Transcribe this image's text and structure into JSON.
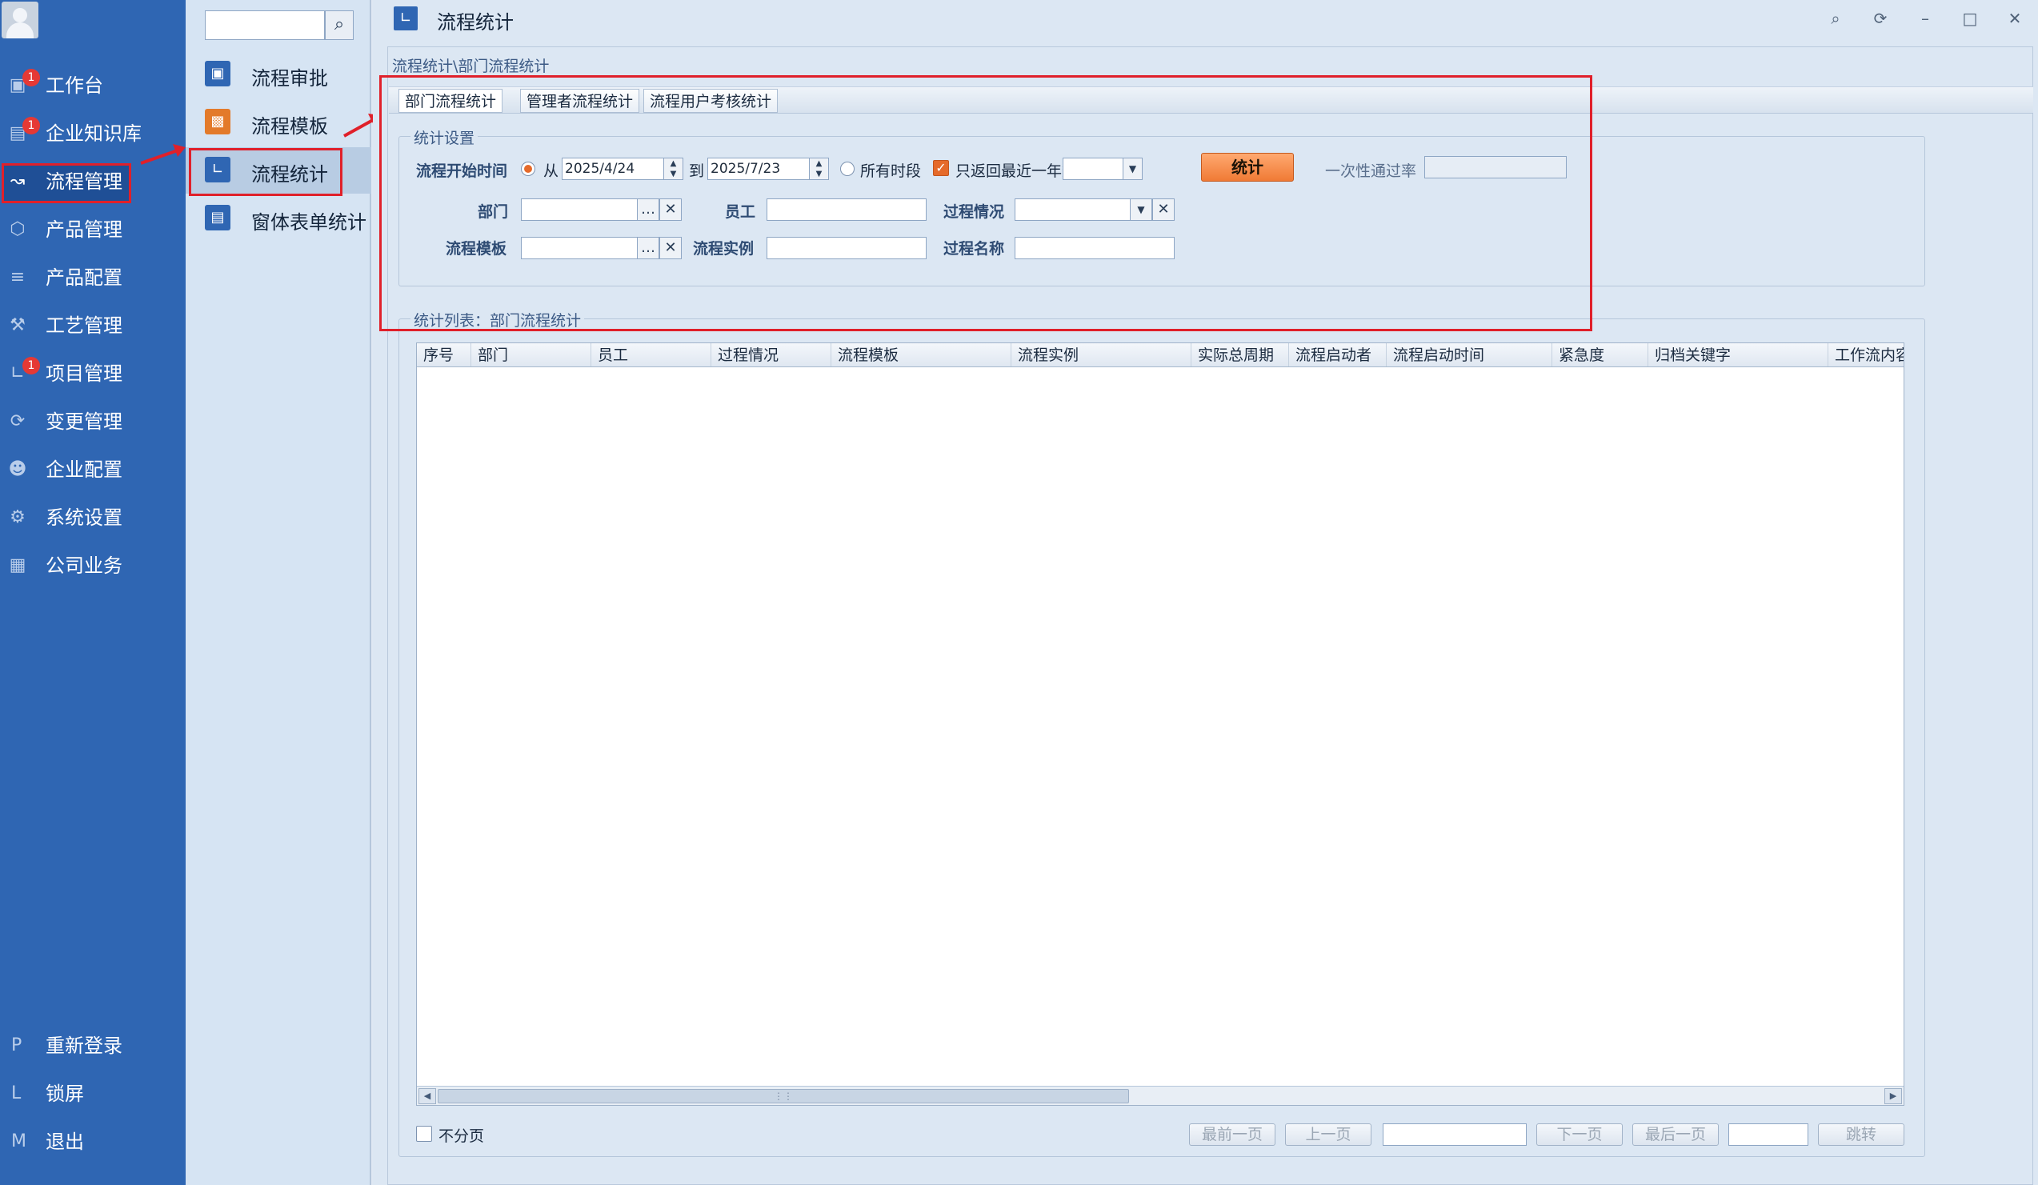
{
  "nav": {
    "items": [
      {
        "label": "工作台",
        "icon": "monitor-icon",
        "badge": "1"
      },
      {
        "label": "企业知识库",
        "icon": "book-icon",
        "badge": "1"
      },
      {
        "label": "流程管理",
        "icon": "trend-icon",
        "badge": ""
      },
      {
        "label": "产品管理",
        "icon": "cube-icon",
        "badge": ""
      },
      {
        "label": "产品配置",
        "icon": "sliders-icon",
        "badge": ""
      },
      {
        "label": "工艺管理",
        "icon": "wrench-icon",
        "badge": ""
      },
      {
        "label": "项目管理",
        "icon": "chart-icon",
        "badge": "1"
      },
      {
        "label": "变更管理",
        "icon": "cycle-icon",
        "badge": ""
      },
      {
        "label": "企业配置",
        "icon": "users-icon",
        "badge": ""
      },
      {
        "label": "系统设置",
        "icon": "gear-icon",
        "badge": ""
      },
      {
        "label": "公司业务",
        "icon": "grid-icon",
        "badge": ""
      }
    ],
    "bottom": [
      {
        "key": "P",
        "label": "重新登录"
      },
      {
        "key": "L",
        "label": "锁屏"
      },
      {
        "key": "M",
        "label": "退出"
      }
    ]
  },
  "submenu": {
    "search_value": "",
    "items": [
      {
        "label": "流程审批",
        "icon": "monitor-icon",
        "color": "#2f66b3"
      },
      {
        "label": "流程模板",
        "icon": "template-icon",
        "color": "#e37a2a"
      },
      {
        "label": "流程统计",
        "icon": "chart-icon",
        "color": "#2f66b3"
      },
      {
        "label": "窗体表单统计",
        "icon": "form-icon",
        "color": "#2f66b3"
      }
    ]
  },
  "main": {
    "title": "流程统计",
    "breadcrumb": "流程统计\\部门流程统计",
    "tabs": [
      "部门流程统计",
      "管理者流程统计",
      "流程用户考核统计"
    ],
    "settings": {
      "group_title": "统计设置",
      "start_time_label": "流程开始时间",
      "from_label": "从",
      "from_date": "2025/4/24",
      "to_label": "到",
      "to_date": "2025/7/23",
      "all_time_label": "所有时段",
      "recent_year_label": "只返回最近一年数据",
      "recent_select": "",
      "stat_button": "统计",
      "pass_rate_label": "一次性通过率",
      "pass_rate_value": "",
      "dept_label": "部门",
      "dept_value": "",
      "employee_label": "员工",
      "employee_value": "",
      "process_status_label": "过程情况",
      "process_status_value": "",
      "template_label": "流程模板",
      "template_value": "",
      "instance_label": "流程实例",
      "instance_value": "",
      "process_name_label": "过程名称",
      "process_name_value": ""
    },
    "list": {
      "group_title": "统计列表：部门流程统计",
      "columns": [
        "序号",
        "部门",
        "员工",
        "过程情况",
        "流程模板",
        "流程实例",
        "实际总周期",
        "流程启动者",
        "流程启动时间",
        "紧急度",
        "归档关键字",
        "工作流内容"
      ]
    },
    "pager": {
      "no_paging_label": "不分页",
      "first": "最前一页",
      "prev": "上一页",
      "page_value": "",
      "next": "下一页",
      "last": "最后一页",
      "jump_value": "",
      "jump": "跳转"
    }
  },
  "colors": {
    "nav_bg": "#2f66b3",
    "highlight": "#e0202a",
    "accent": "#f07a35"
  }
}
